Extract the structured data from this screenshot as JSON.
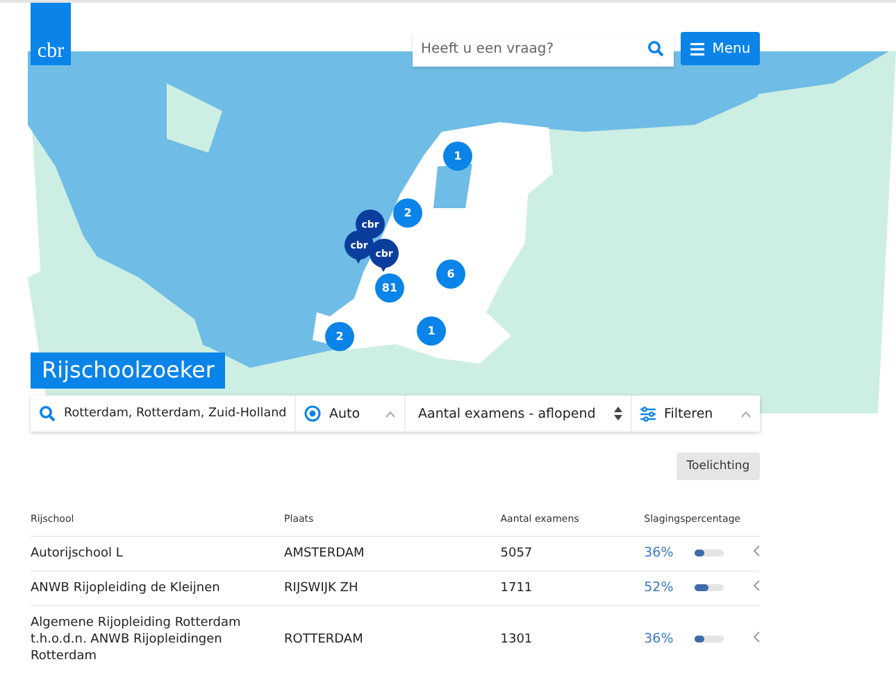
{
  "logo": {
    "text": "cbr"
  },
  "search": {
    "placeholder": "Heeft u een vraag?"
  },
  "menu_button": {
    "label": "Menu"
  },
  "map": {
    "clusters": [
      {
        "count": "1"
      },
      {
        "count": "2"
      },
      {
        "count": "6"
      },
      {
        "count": "81"
      },
      {
        "count": "1"
      },
      {
        "count": "2"
      }
    ],
    "markers": [
      {
        "label": "cbr"
      },
      {
        "label": "cbr"
      },
      {
        "label": "cbr"
      }
    ]
  },
  "title": "Rijschoolzoeker",
  "filters": {
    "location": "Rotterdam, Rotterdam, Zuid-Holland",
    "vehicle": "Auto",
    "sort": "Aantal examens - aflopend",
    "filter": "Filteren"
  },
  "explain_button": "Toelichting",
  "table": {
    "columns": [
      "Rijschool",
      "Plaats",
      "Aantal examens",
      "Slagingspercentage"
    ],
    "rows": [
      {
        "school": "Autorijschool L",
        "place": "AMSTERDAM",
        "exams": "5057",
        "rate": "36%",
        "level": 0.36
      },
      {
        "school": "ANWB Rijopleiding de Kleijnen",
        "place": "RIJSWIJK ZH",
        "exams": "1711",
        "rate": "52%",
        "level": 0.52
      },
      {
        "school": "Algemene Rijopleiding Rotterdam t.h.o.d.n. ANWB Rijopleidingen Rotterdam",
        "place": "ROTTERDAM",
        "exams": "1301",
        "rate": "36%",
        "level": 0.36
      }
    ]
  }
}
